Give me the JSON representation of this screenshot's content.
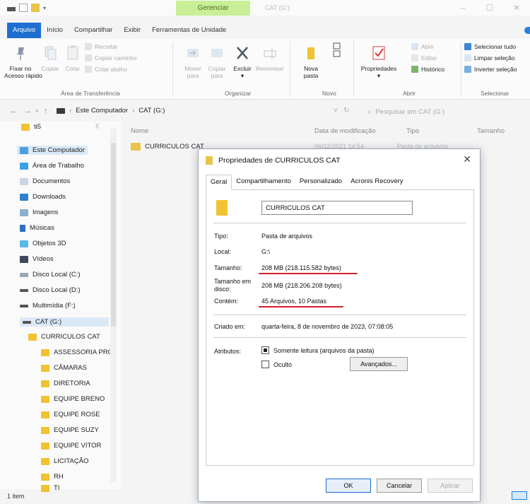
{
  "window": {
    "context_tab": "Gerenciar",
    "title": "CAT (G:)"
  },
  "tabs": [
    "Arquivo",
    "Início",
    "Compartilhar",
    "Exibir",
    "Ferramentas de Unidade"
  ],
  "ribbon": {
    "pin": "Fixar no\nAcesso rápido",
    "copy": "Copiar",
    "paste": "Colar",
    "cut": "Recortar",
    "copy_path": "Copiar caminho",
    "paste_shortcut": "Colar atalho",
    "move_to": "Mover\npara",
    "copy_to": "Copiar\npara",
    "delete": "Excluir",
    "rename": "Renomear",
    "new_folder": "Nova\npasta",
    "properties": "Propriedades",
    "open": "Abrir",
    "edit": "Editar",
    "history": "Histórico",
    "select_all": "Selecionar tudo",
    "select_none": "Limpar seleção",
    "invert": "Inverter seleção",
    "groups": {
      "clipboard": "Área de Transferência",
      "organize": "Organizar",
      "new": "Novo",
      "open": "Abrir",
      "select": "Selecionar"
    }
  },
  "address": {
    "crumbs": [
      "Este Computador",
      "CAT (G:)"
    ],
    "search_placeholder": "Pesquisar em CAT (G:)"
  },
  "nav": {
    "items": [
      {
        "label": "ti5"
      },
      {
        "label": "Este Computador"
      },
      {
        "label": "Área de Trabalho"
      },
      {
        "label": "Documentos"
      },
      {
        "label": "Downloads"
      },
      {
        "label": "Imagens"
      },
      {
        "label": "Músicas"
      },
      {
        "label": "Objetos 3D"
      },
      {
        "label": "Vídeos"
      },
      {
        "label": "Disco Local (C:)"
      },
      {
        "label": "Disco Local (D:)"
      },
      {
        "label": "Multimídia (F:)"
      },
      {
        "label": "CAT (G:)"
      },
      {
        "label": "CURRICULOS CAT"
      },
      {
        "label": "ASSESSORIA PRC"
      },
      {
        "label": "CÂMARAS"
      },
      {
        "label": "DIRETORIA"
      },
      {
        "label": "EQUIPE BRENO"
      },
      {
        "label": "EQUIPE ROSE"
      },
      {
        "label": "EQUIPE SUZY"
      },
      {
        "label": "EQUIPE VITOR"
      },
      {
        "label": "LICITAÇÃO"
      },
      {
        "label": "RH"
      },
      {
        "label": "TI"
      }
    ],
    "status": "1 item"
  },
  "filelist": {
    "headers": [
      "Nome",
      "Data de modificação",
      "Tipo",
      "Tamanho"
    ],
    "rows": [
      {
        "name": "CURRICULOS CAT",
        "date": "06/12/2021 14:54",
        "type": "Pasta de arquivos"
      }
    ]
  },
  "dialog": {
    "title": "Propriedades de CURRICULOS CAT",
    "tabs": [
      "Geral",
      "Compartilhamento",
      "Personalizado",
      "Acronis Recovery"
    ],
    "name": "CURRICULOS CAT",
    "fields": {
      "tipo_label": "Tipo:",
      "tipo": "Pasta de arquivos",
      "local_label": "Local:",
      "local": "G:\\",
      "tamanho_label": "Tamanho:",
      "tamanho": "208 MB (218.115.582 bytes)",
      "disco_label": "Tamanho em\ndisco:",
      "disco": "208 MB (218.206.208 bytes)",
      "contem_label": "Contém:",
      "contem": "45 Arquivos, 10 Pastas",
      "criado_label": "Criado em:",
      "criado": "quarta-feira, 8 de novembro de 2023, 07:08:05",
      "atributos_label": "Atributos:",
      "readonly": "Somente leitura (arquivos da pasta)",
      "hidden": "Oculto",
      "advanced": "Avançados..."
    },
    "buttons": {
      "ok": "OK",
      "cancel": "Cancelar",
      "apply": "Aplicar"
    },
    "annotation_color": "#d1202a"
  }
}
